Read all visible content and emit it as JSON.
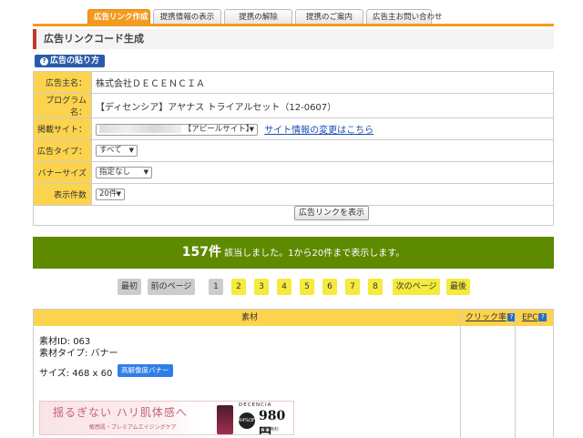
{
  "tabs": [
    {
      "label": "広告リンク作成",
      "active": true
    },
    {
      "label": "提携情報の表示",
      "active": false
    },
    {
      "label": "提携の解除",
      "active": false
    },
    {
      "label": "提携のご案内",
      "active": false
    },
    {
      "label": "広告主お問い合わせ",
      "active": false
    }
  ],
  "page_title": "広告リンクコード生成",
  "help_button": "広告の貼り方",
  "form": {
    "advertiser": {
      "label": "広告主名：",
      "value": "株式会社ＤＥＣＥＮＣＩＡ"
    },
    "program": {
      "label": "プログラム名：",
      "value": "【ディセンシア】アヤナス トライアルセット（12-0607）"
    },
    "site": {
      "label": "掲載サイト：",
      "select_value": "【アピールサイト】",
      "link": "サイト情報の変更はこちら"
    },
    "ad_type": {
      "label": "広告タイプ：",
      "select_value": "すべて"
    },
    "banner_size": {
      "label": "バナーサイズ",
      "select_value": "指定なし"
    },
    "per_page": {
      "label": "表示件数",
      "select_value": "20件"
    },
    "submit": "広告リンクを表示"
  },
  "result": {
    "count": "157件",
    "text": "該当しました。1から20件まで表示します。"
  },
  "pager": {
    "first": "最初",
    "prev": "前のページ",
    "pages": [
      "1",
      "2",
      "3",
      "4",
      "5",
      "6",
      "7",
      "8"
    ],
    "current_page": "1",
    "next": "次のページ",
    "last": "最後"
  },
  "results_table": {
    "headers": {
      "material": "素材",
      "click_rate": "クリック率",
      "epc": "EPC"
    },
    "item": {
      "id_line": "素材ID: 063",
      "type_line": "素材タイプ: バナー",
      "size_line": "サイズ: 468 x 60",
      "hires_label": "高解像度バナー",
      "banner": {
        "copy": "揺るぎない ハリ肌体感へ",
        "sub": "敏感肌・プレミアムエイジングケア",
        "brand": "DECENCIA",
        "discount": "64%OFF",
        "price": "980円",
        "shipping": "送料無料"
      }
    }
  },
  "colors": {
    "tab_active": "#f39a21",
    "label_bg": "#fcd34d",
    "result_bar": "#5e8a00",
    "pager_yellow": "#f5ea3d",
    "accent_red": "#c0392b",
    "link": "#1a4fb0"
  }
}
